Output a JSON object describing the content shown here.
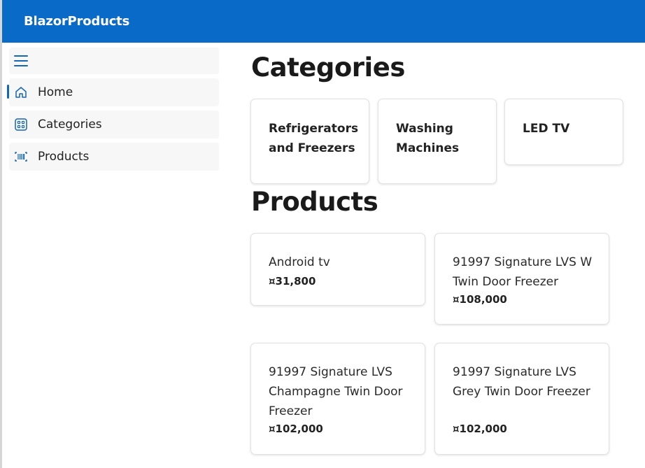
{
  "app": {
    "brand": "BlazorProducts"
  },
  "colors": {
    "accent": "#0a6ac7",
    "nav_icon": "#1565b8"
  },
  "sidebar": {
    "toggle_icon": "hamburger-icon",
    "items": [
      {
        "label": "Home",
        "icon": "home-icon",
        "active": true
      },
      {
        "label": "Categories",
        "icon": "grid-icon",
        "active": false
      },
      {
        "label": "Products",
        "icon": "barcode-icon",
        "active": false
      }
    ]
  },
  "main": {
    "categories_title": "Categories",
    "categories": [
      {
        "name": "Refrigerators and Freezers"
      },
      {
        "name": "Washing Machines"
      },
      {
        "name": "LED TV"
      }
    ],
    "products_title": "Products",
    "products": [
      {
        "name": "Android tv",
        "price": "¤31,800"
      },
      {
        "name": "91997 Signature LVS W Twin Door Freezer",
        "price": "¤108,000"
      },
      {
        "name": "91997 Signature LVS Champagne Twin Door Freezer",
        "price": "¤102,000"
      },
      {
        "name": "91997 Signature LVS Grey Twin Door Freezer",
        "price": "¤102,000"
      }
    ]
  }
}
